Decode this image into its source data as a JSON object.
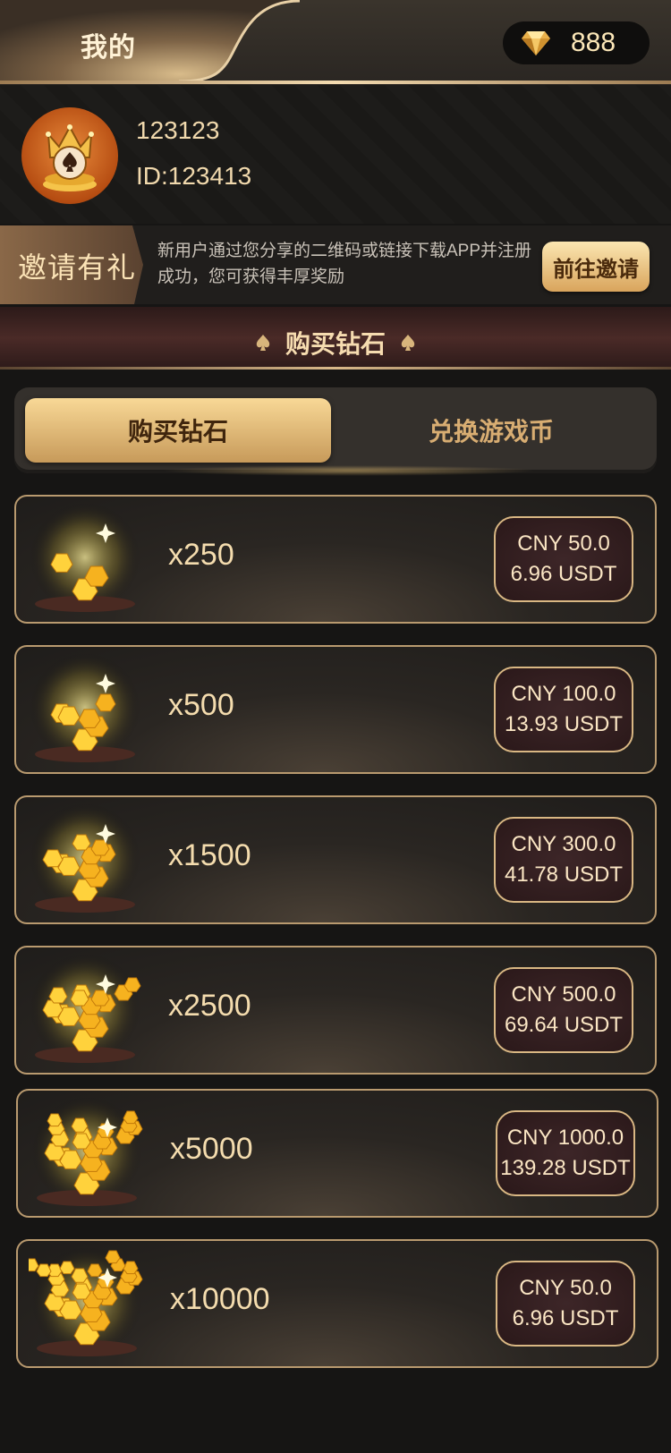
{
  "header": {
    "title": "我的",
    "diamond_count": "888"
  },
  "profile": {
    "username": "123123",
    "user_id": "ID:123413"
  },
  "invite": {
    "label": "邀请有礼",
    "description": "新用户通过您分享的二维码或链接下载APP并注册成功，您可获得丰厚奖励",
    "button": "前往邀请"
  },
  "section": {
    "title": "购买钻石"
  },
  "tabs": [
    {
      "label": "购买钻石",
      "active": true
    },
    {
      "label": "兑换游戏币",
      "active": false
    }
  ],
  "packages": [
    {
      "amount": "x250",
      "cny": "CNY 50.0",
      "usdt": "6.96 USDT"
    },
    {
      "amount": "x500",
      "cny": "CNY 100.0",
      "usdt": "13.93 USDT"
    },
    {
      "amount": "x1500",
      "cny": "CNY 300.0",
      "usdt": "41.78 USDT"
    },
    {
      "amount": "x2500",
      "cny": "CNY 500.0",
      "usdt": "69.64 USDT"
    },
    {
      "amount": "x5000",
      "cny": "CNY 1000.0",
      "usdt": "139.28 USDT"
    },
    {
      "amount": "x10000",
      "cny": "CNY 50.0",
      "usdt": "6.96 USDT"
    }
  ],
  "colors": {
    "accent_gold": "#f4dcae",
    "button_gold": "#d9a45c",
    "background": "#161514"
  }
}
